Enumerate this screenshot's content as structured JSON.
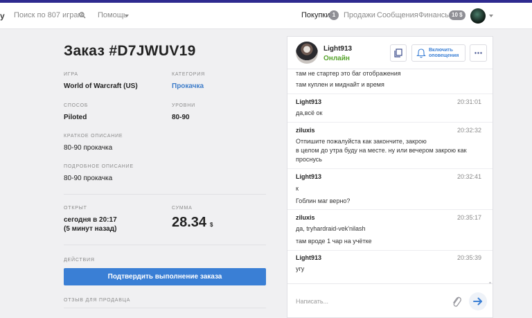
{
  "topbar": {
    "logo_fragment": "y",
    "search_placeholder": "Поиск по 807 играм",
    "help_label": "Помощь",
    "nav": {
      "purchases": "Покупки",
      "purchases_badge": "1",
      "sales": "Продажи",
      "messages": "Сообщения",
      "finance": "Финансы",
      "finance_badge": "10 $"
    }
  },
  "order": {
    "title": "Заказ #D7JWUV19",
    "game_label": "ИГРА",
    "game_value": "World of Warcraft (US)",
    "category_label": "КАТЕГОРИЯ",
    "category_value": "Прокачка",
    "method_label": "СПОСОБ",
    "method_value": "Piloted",
    "levels_label": "УРОВНИ",
    "levels_value": "80-90",
    "short_desc_label": "КРАТКОЕ ОПИСАНИЕ",
    "short_desc_value": "80-90 прокачка",
    "full_desc_label": "ПОДРОБНОЕ ОПИСАНИЕ",
    "full_desc_value": "80-90 прокачка",
    "opened_label": "ОТКРЫТ",
    "opened_value_line1": "сегодня в 20:17",
    "opened_value_line2": "(5 минут назад)",
    "sum_label": "СУММА",
    "sum_value": "28.34",
    "sum_currency": "$",
    "actions_label": "ДЕЙСТВИЯ",
    "confirm_button": "Подтвердить выполнение заказа",
    "review_label": "ОТЗЫВ ДЛЯ ПРОДАВЦА"
  },
  "chat": {
    "user_name": "Light913",
    "user_status": "Онлайн",
    "notify_line1": "Включить",
    "notify_line2": "оповещения",
    "input_placeholder": "Написать...",
    "messages": [
      {
        "lines": [
          "там не стартер это баг отображения",
          "там куплен и миднайт и время"
        ]
      },
      {
        "author": "Light913",
        "time": "20:31:01",
        "lines": [
          "да,всё ок"
        ]
      },
      {
        "author": "ziluxis",
        "time": "20:32:32",
        "lines": [
          "Отпишите пожалуйста как закончите, закрою",
          "в целом до утра буду на месте. ну или вечером закрою как",
          "проснусь"
        ]
      },
      {
        "author": "Light913",
        "time": "20:32:41",
        "lines": [
          "к",
          "Гоблин маг верно?"
        ]
      },
      {
        "author": "ziluxis",
        "time": "20:35:17",
        "lines": [
          "да, tryhardraid-vek'nilash",
          "там вроде 1 чар на учётке"
        ]
      },
      {
        "author": "Light913",
        "time": "20:35:39",
        "lines": [
          "угу"
        ]
      }
    ]
  },
  "colors": {
    "accent": "#3a7fd5",
    "online": "#55a32a",
    "topstripe": "#2e2a8f"
  }
}
